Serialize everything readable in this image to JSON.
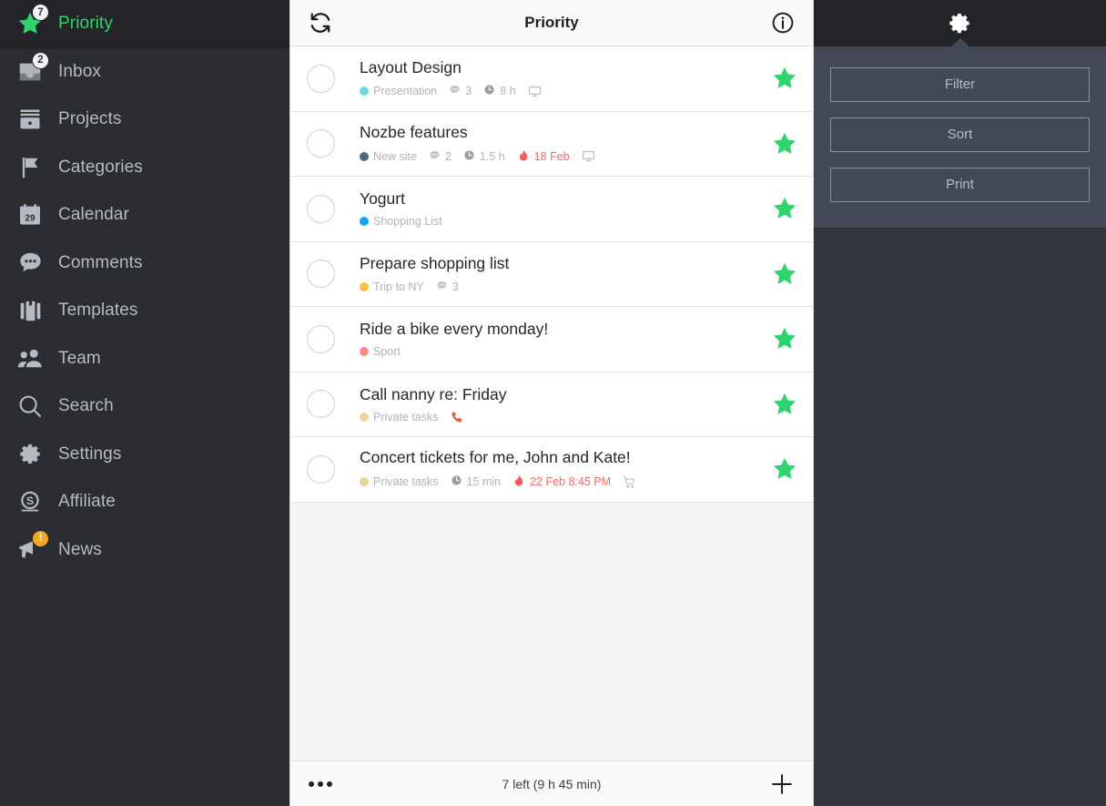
{
  "sidebar": {
    "items": [
      {
        "label": "Priority",
        "icon": "star-icon",
        "badge": "7",
        "badge_type": "count",
        "active": true
      },
      {
        "label": "Inbox",
        "icon": "inbox-icon",
        "badge": "2",
        "badge_type": "count",
        "active": false
      },
      {
        "label": "Projects",
        "icon": "projects-icon",
        "badge": "",
        "badge_type": "",
        "active": false
      },
      {
        "label": "Categories",
        "icon": "flag-icon",
        "badge": "",
        "badge_type": "",
        "active": false
      },
      {
        "label": "Calendar",
        "icon": "calendar-icon",
        "badge": "",
        "badge_type": "",
        "active": false,
        "icon_text": "29"
      },
      {
        "label": "Comments",
        "icon": "comments-icon",
        "badge": "",
        "badge_type": "",
        "active": false
      },
      {
        "label": "Templates",
        "icon": "templates-icon",
        "badge": "",
        "badge_type": "",
        "active": false
      },
      {
        "label": "Team",
        "icon": "team-icon",
        "badge": "",
        "badge_type": "",
        "active": false
      },
      {
        "label": "Search",
        "icon": "search-icon",
        "badge": "",
        "badge_type": "",
        "active": false
      },
      {
        "label": "Settings",
        "icon": "gear-icon",
        "badge": "",
        "badge_type": "",
        "active": false
      },
      {
        "label": "Affiliate",
        "icon": "dollar-icon",
        "badge": "",
        "badge_type": "",
        "active": false
      },
      {
        "label": "News",
        "icon": "megaphone-icon",
        "badge": "!",
        "badge_type": "warn",
        "active": false
      }
    ]
  },
  "main": {
    "header": {
      "sync_icon": "sync-icon",
      "title": "Priority",
      "info_icon": "info-icon"
    },
    "tasks": [
      {
        "name": "Layout Design",
        "project": "Presentation",
        "project_color": "#6fd9e8",
        "comments": "3",
        "time": "8 h",
        "due": "",
        "trailing_icon": "monitor-icon",
        "starred": true
      },
      {
        "name": "Nozbe features",
        "project": "New site",
        "project_color": "#4f6a7d",
        "comments": "2",
        "time": "1.5 h",
        "due": "18 Feb",
        "trailing_icon": "monitor-icon",
        "starred": true
      },
      {
        "name": "Yogurt",
        "project": "Shopping List",
        "project_color": "#12a5f4",
        "comments": "",
        "time": "",
        "due": "",
        "trailing_icon": "",
        "starred": true
      },
      {
        "name": "Prepare shopping list",
        "project": "Trip to NY",
        "project_color": "#fbbf41",
        "comments": "3",
        "time": "",
        "due": "",
        "trailing_icon": "",
        "starred": true
      },
      {
        "name": "Ride a bike every monday!",
        "project": "Sport",
        "project_color": "#f98b7d",
        "comments": "",
        "time": "",
        "due": "",
        "trailing_icon": "",
        "starred": true
      },
      {
        "name": "Call nanny re: Friday",
        "project": "Private tasks",
        "project_color": "#ecd39a",
        "comments": "",
        "time": "",
        "due": "",
        "trailing_icon": "phone-icon",
        "starred": true
      },
      {
        "name": "Concert tickets for me, John and Kate!",
        "project": "Private tasks",
        "project_color": "#ecd39a",
        "comments": "",
        "time": "15 min",
        "due": "22 Feb 8:45 PM",
        "trailing_icon": "cart-icon",
        "starred": true
      }
    ],
    "footer": {
      "more_icon": "more-dots-icon",
      "count_label": "7 left (9 h 45 min)",
      "add_icon": "plus-icon"
    }
  },
  "rightpane": {
    "gear_icon": "gear-icon",
    "buttons": [
      {
        "label": "Filter"
      },
      {
        "label": "Sort"
      },
      {
        "label": "Print"
      }
    ]
  },
  "colors": {
    "accent_green": "#2fd46e",
    "due_red": "#ff6363",
    "warn_orange": "#f5a623",
    "sidebar_bg": "#2b2d33",
    "sidebar_active_bg": "#232428",
    "popover_bg": "#434954"
  }
}
